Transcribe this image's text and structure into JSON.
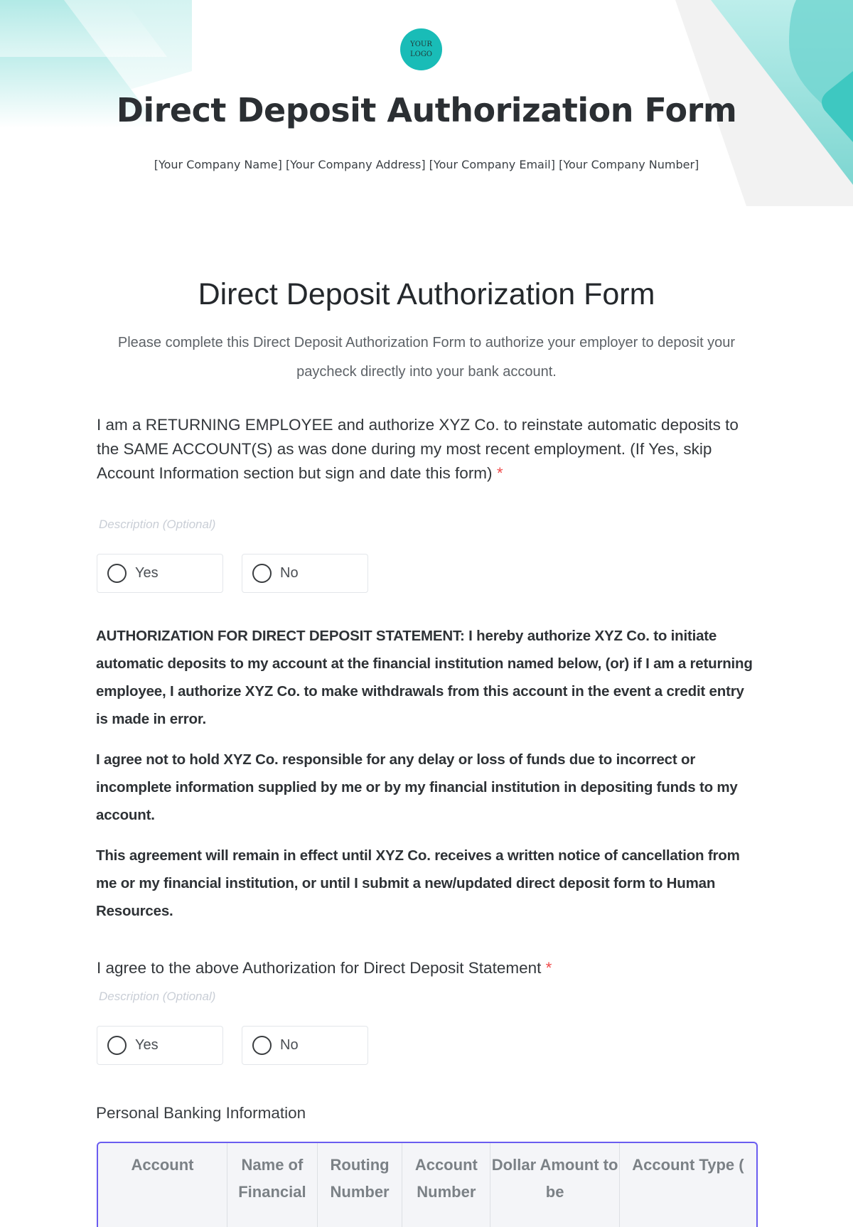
{
  "header": {
    "logo_line1": "YOUR",
    "logo_line2": "LOGO",
    "title": "Direct Deposit Authorization Form",
    "company_line": "[Your Company Name] [Your Company Address] [Your Company Email] [Your Company Number]",
    "accent_color": "#19bcb7"
  },
  "form": {
    "title": "Direct Deposit Authorization Form",
    "intro": "Please complete this Direct Deposit Authorization Form to authorize your employer to deposit your paycheck directly into your bank account.",
    "questions": [
      {
        "label": "I am a RETURNING EMPLOYEE and authorize XYZ Co. to reinstate automatic deposits to the SAME ACCOUNT(S) as was done during my most recent employment. (If Yes, skip Account Information section but sign and date this form)",
        "required_mark": "*",
        "description_placeholder": "Description (Optional)",
        "options": [
          "Yes",
          "No"
        ]
      },
      {
        "label": "I agree to the above Authorization for Direct Deposit Statement",
        "required_mark": "*",
        "description_placeholder": "Description (Optional)",
        "options": [
          "Yes",
          "No"
        ]
      }
    ],
    "statements": [
      "AUTHORIZATION FOR DIRECT DEPOSIT STATEMENT: I hereby authorize XYZ Co. to initiate automatic deposits to my account at the financial institution named below, (or) if I am a returning employee, I authorize XYZ Co. to make withdrawals from this account in the event a credit entry is made in error.",
      "I agree not to hold XYZ Co. responsible for any delay or loss of funds due to incorrect or incomplete information supplied by me or by my financial institution in depositing funds to my account.",
      "This agreement will remain in effect until XYZ Co. receives a written notice of cancellation from me or my financial institution, or until I submit a new/updated direct deposit form to Human Resources."
    ],
    "banking_section": {
      "label": "Personal Banking Information",
      "columns": [
        "Account",
        "Name of Financial",
        "Routing Number",
        "Account Number",
        "Dollar Amount to be",
        "Account Type ("
      ],
      "border_color": "#6a5cf0"
    }
  }
}
